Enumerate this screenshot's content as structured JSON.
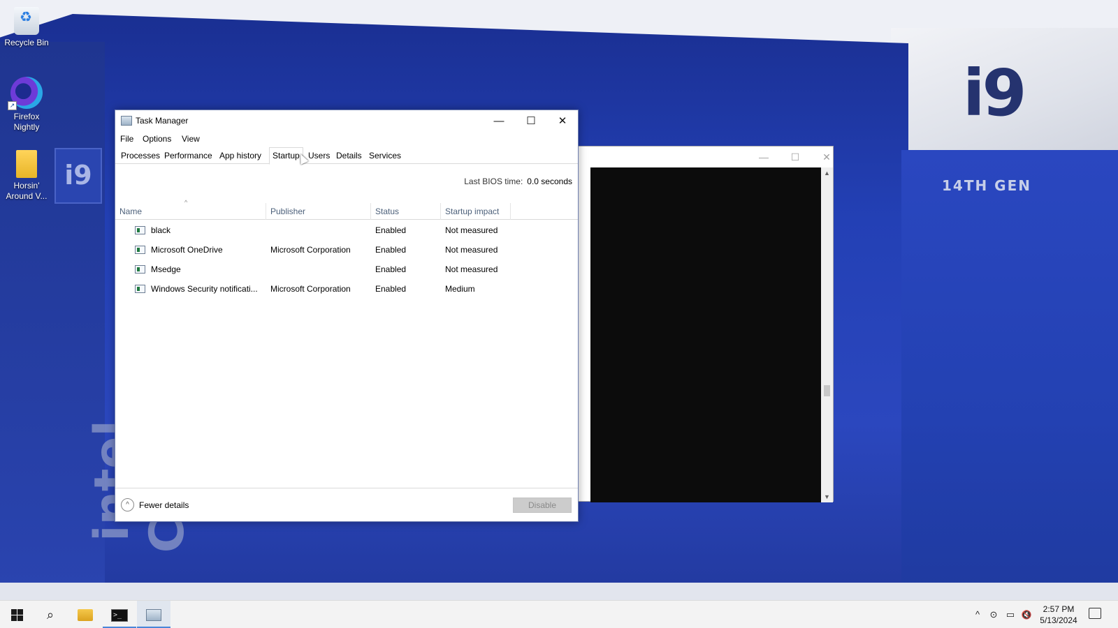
{
  "desktop": {
    "wallpaper_text": {
      "brand_model": "i9",
      "generation": "14TH GEN",
      "brand": "intel CORE",
      "small_badge": "i9"
    },
    "icons": [
      {
        "label": "Recycle Bin"
      },
      {
        "label": "Firefox Nightly"
      },
      {
        "label": "Horsin' Around V..."
      }
    ]
  },
  "console_window": {
    "controls": {
      "minimize": "—",
      "maximize": "☐",
      "close": "✕"
    },
    "scroll_up": "▲",
    "scroll_down": "▼"
  },
  "task_manager": {
    "title": "Task Manager",
    "controls": {
      "minimize": "—",
      "maximize": "☐",
      "close": "✕"
    },
    "menu": [
      "File",
      "Options",
      "View"
    ],
    "tabs": [
      "Processes",
      "Performance",
      "App history",
      "Startup",
      "Users",
      "Details",
      "Services"
    ],
    "active_tab": "Startup",
    "bios_label": "Last BIOS time:",
    "bios_value": "0.0 seconds",
    "sort_indicator": "^",
    "columns": {
      "name": "Name",
      "publisher": "Publisher",
      "status": "Status",
      "impact": "Startup impact"
    },
    "rows": [
      {
        "name": "black",
        "publisher": "",
        "status": "Enabled",
        "impact": "Not measured"
      },
      {
        "name": "Microsoft OneDrive",
        "publisher": "Microsoft Corporation",
        "status": "Enabled",
        "impact": "Not measured"
      },
      {
        "name": "Msedge",
        "publisher": "",
        "status": "Enabled",
        "impact": "Not measured"
      },
      {
        "name": "Windows Security notificati...",
        "publisher": "Microsoft Corporation",
        "status": "Enabled",
        "impact": "Medium"
      }
    ],
    "footer": {
      "fewer_details": "Fewer details",
      "fewer_icon": "^",
      "disable_button": "Disable"
    }
  },
  "taskbar": {
    "search_icon": "⌕",
    "tray": {
      "chevron": "^",
      "meet": "⊙",
      "network": "▭",
      "volume": "🔇"
    },
    "time": "2:57 PM",
    "date": "5/13/2024",
    "cmd_glyph": ">_"
  }
}
